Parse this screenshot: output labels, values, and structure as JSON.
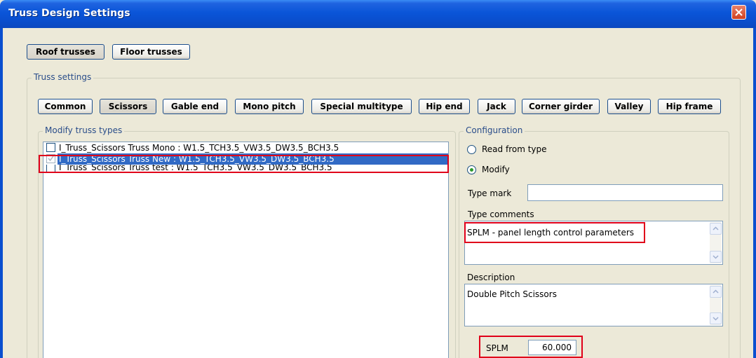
{
  "window": {
    "title": "Truss Design Settings",
    "close_icon": "close-icon"
  },
  "top_tabs": {
    "roof": "Roof trusses",
    "floor": "Floor trusses"
  },
  "truss_settings": {
    "label": "Truss settings",
    "types": [
      "Common",
      "Scissors",
      "Gable end",
      "Mono pitch",
      "Special multitype",
      "Hip end",
      "Jack",
      "Corner girder",
      "Valley",
      "Hip frame"
    ],
    "selected": "Scissors"
  },
  "modify_types": {
    "label": "Modify truss types",
    "items": [
      {
        "text": "I_Truss_Scissors Truss Mono : W1.5_TCH3.5_VW3.5_DW3.5_BCH3.5",
        "checked": false,
        "selected": false
      },
      {
        "text": "I_Truss_Scissors Truss New : W1.5_TCH3.5_VW3.5_DW3.5_BCH3.5",
        "checked": true,
        "selected": true
      },
      {
        "text": "I_Truss_Scissors Truss test : W1.5_TCH3.5_VW3.5_DW3.5_BCH3.5",
        "checked": false,
        "selected": false
      }
    ]
  },
  "configuration": {
    "label": "Configuration",
    "read_from_type": "Read from type",
    "modify": "Modify",
    "selected_option": "Modify",
    "type_mark_label": "Type mark",
    "type_mark_value": "",
    "type_comments_label": "Type comments",
    "type_comments_value": "SPLM - panel length control parameters",
    "description_label": "Description",
    "description_value": "Double Pitch Scissors",
    "splm_label": "SPLM",
    "splm_value": "60.000"
  },
  "colors": {
    "titlebar": "#0a55d8",
    "dialog_bg": "#ece9d8",
    "selection": "#316ac5",
    "highlight_box": "#e0001a"
  }
}
